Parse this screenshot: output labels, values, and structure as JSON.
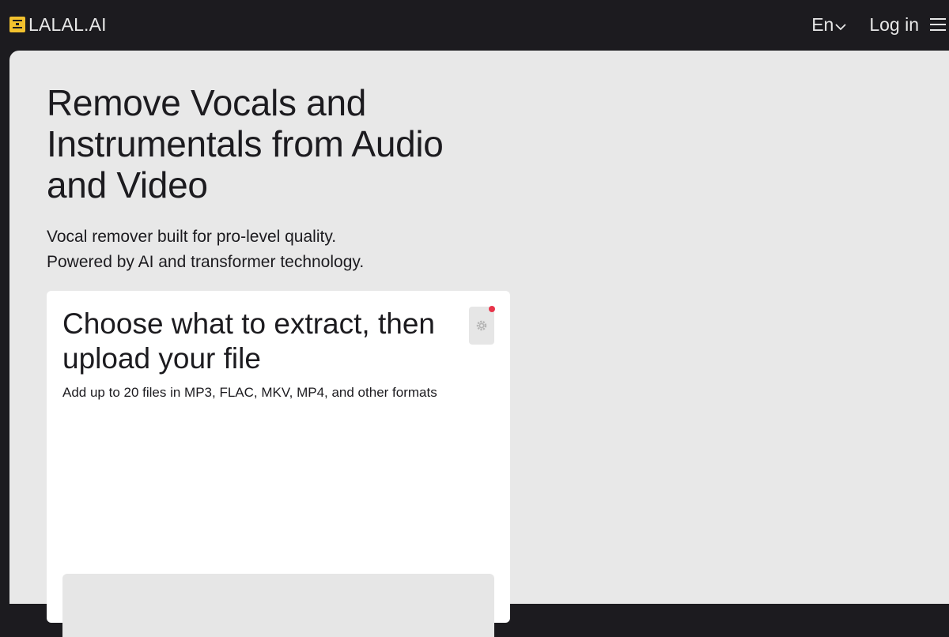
{
  "brand": {
    "name": "LALAL.AI",
    "accent_color": "#f2c12e"
  },
  "header": {
    "language": "En",
    "login_label": "Log in",
    "icons": [
      "logo-icon",
      "chevron-down-icon",
      "hamburger-menu-icon"
    ]
  },
  "hero": {
    "title": "Remove Vocals and Instrumentals from Audio and Video",
    "subtitle_line1": "Vocal remover built for pro-level quality.",
    "subtitle_line2": "Powered by AI and transformer technology."
  },
  "card": {
    "title": "Choose what to extract, then upload your file",
    "description": "Add up to 20 files in MP3, FLAC, MKV, MP4, and other formats",
    "settings_icon": "gear-icon",
    "notification_color": "#e8344a"
  }
}
